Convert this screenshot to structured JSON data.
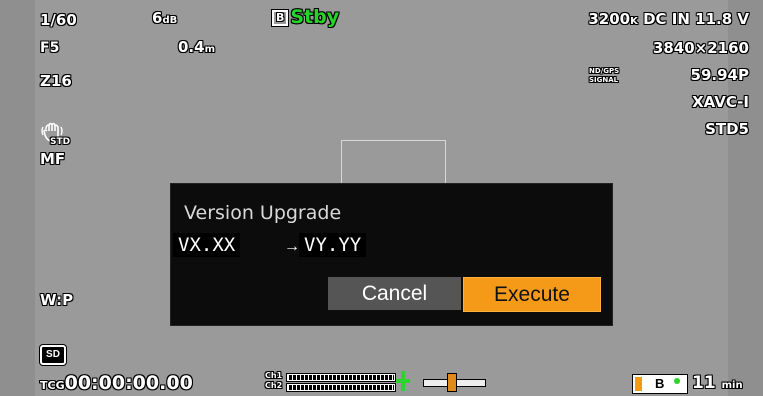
{
  "top_left": {
    "shutter": "1/60",
    "gain": "6",
    "gain_unit": "dB",
    "iris": "F5",
    "focus_distance": "0.4",
    "focus_unit": "m",
    "zoom": "Z16",
    "steady_shot": "STD",
    "focus_mode": "MF",
    "white_balance": "W:P"
  },
  "top_center": {
    "slot": "B",
    "status": "Stby"
  },
  "top_right": {
    "color_temp": "3200",
    "color_temp_unit": "K",
    "power": "DC IN 11.8 V",
    "resolution": "3840×2160",
    "nd_gps_label_1": "ND/GPS",
    "nd_gps_label_2": "SIGNAL",
    "frame_rate": "59.94P",
    "codec": "XAVC-I",
    "picture_profile": "STD5"
  },
  "dialog": {
    "title": "Version Upgrade",
    "from_version": "VX.XX",
    "arrow": "→",
    "to_version": "VY.YY",
    "cancel_label": "Cancel",
    "execute_label": "Execute"
  },
  "bottom": {
    "media": "SD",
    "timecode_prefix": "TCG",
    "timecode": "00:00:00.00",
    "ch1_label": "Ch1",
    "ch2_label": "Ch2",
    "media_slot": "B",
    "remaining": "11",
    "remaining_unit": "min"
  },
  "colors": {
    "stby": "#26d326",
    "execute": "#f59a18",
    "level": "#2bd52b"
  }
}
